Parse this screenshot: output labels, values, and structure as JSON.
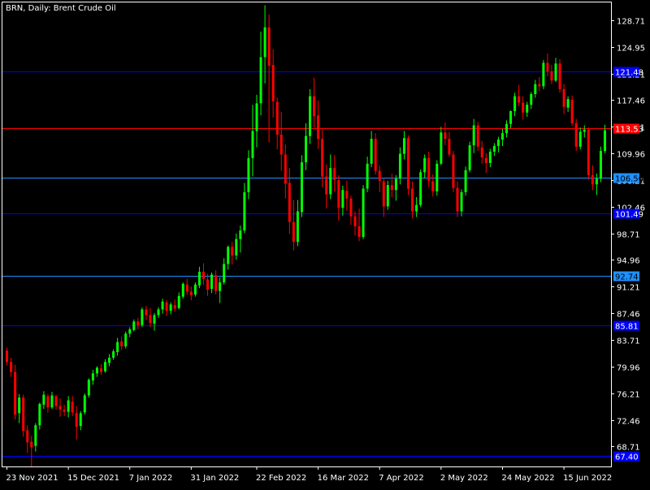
{
  "header": {
    "symbol_label": "BRN, Daily:  Brent Crude Oil"
  },
  "colors": {
    "background": "#000000",
    "axis": "#ffffff",
    "bull_candle": "#00ff00",
    "bear_candle": "#ff0000",
    "red_level": "#ff0000",
    "deep_blue_level": "#0000ff",
    "light_blue_level": "#1e90ff"
  },
  "chart_data": {
    "type": "candlestick",
    "title": "BRN, Daily:  Brent Crude Oil",
    "timeframe": "Daily",
    "y_ticks": [
      "128.71",
      "124.95",
      "121.21",
      "117.46",
      "113.71",
      "109.96",
      "106.21",
      "102.46",
      "98.71",
      "94.96",
      "91.21",
      "87.46",
      "83.71",
      "79.96",
      "76.21",
      "72.46",
      "68.71"
    ],
    "ylim": [
      65.9,
      131.2
    ],
    "x_ticks": [
      "23 Nov 2021",
      "15 Dec 2021",
      "7 Jan 2022",
      "31 Jan 2022",
      "22 Feb 2022",
      "16 Mar 2022",
      "7 Apr 2022",
      "2 May 2022",
      "24 May 2022",
      "15 Jun 2022"
    ],
    "levels": [
      {
        "value": 121.48,
        "label": "121.48",
        "color": "deep-blue"
      },
      {
        "value": 113.53,
        "label": "113.53",
        "color": "red"
      },
      {
        "value": 106.56,
        "label": "106.56",
        "color": "light-blue"
      },
      {
        "value": 101.49,
        "label": "101.49",
        "color": "deep-blue"
      },
      {
        "value": 92.74,
        "label": "92.74",
        "color": "light-blue"
      },
      {
        "value": 85.81,
        "label": "85.81",
        "color": "deep-blue"
      },
      {
        "value": 67.4,
        "label": "67.40",
        "color": "deep-blue"
      }
    ],
    "candles_ohlc": [
      [
        82.2,
        82.6,
        80.1,
        80.6
      ],
      [
        80.6,
        81.2,
        78.5,
        79.2
      ],
      [
        79.2,
        80.2,
        72.5,
        73.2
      ],
      [
        73.4,
        76.1,
        72.0,
        75.6
      ],
      [
        75.6,
        76.0,
        70.1,
        70.9
      ],
      [
        71.0,
        71.7,
        67.8,
        69.3
      ],
      [
        69.4,
        70.2,
        65.9,
        68.6
      ],
      [
        68.8,
        72.0,
        68.0,
        71.7
      ],
      [
        71.7,
        74.9,
        71.1,
        74.7
      ],
      [
        74.6,
        76.5,
        74.0,
        76.0
      ],
      [
        75.8,
        76.1,
        73.5,
        74.2
      ],
      [
        74.2,
        76.4,
        74.0,
        75.9
      ],
      [
        75.8,
        76.0,
        73.9,
        74.4
      ],
      [
        74.4,
        75.5,
        72.9,
        73.9
      ],
      [
        73.9,
        74.6,
        73.0,
        73.6
      ],
      [
        73.6,
        75.8,
        72.8,
        75.2
      ],
      [
        75.0,
        75.8,
        73.0,
        73.5
      ],
      [
        73.4,
        74.4,
        69.7,
        71.5
      ],
      [
        71.6,
        73.7,
        71.0,
        73.4
      ],
      [
        73.5,
        76.2,
        73.2,
        75.9
      ],
      [
        75.9,
        78.3,
        75.6,
        78.1
      ],
      [
        78.0,
        79.5,
        77.4,
        79.0
      ],
      [
        79.0,
        80.0,
        78.5,
        79.8
      ],
      [
        79.7,
        80.3,
        78.8,
        79.2
      ],
      [
        79.3,
        81.0,
        79.1,
        80.6
      ],
      [
        80.5,
        81.7,
        80.0,
        81.2
      ],
      [
        81.2,
        82.4,
        80.9,
        82.1
      ],
      [
        82.0,
        84.0,
        81.5,
        83.4
      ],
      [
        83.5,
        84.2,
        82.3,
        82.8
      ],
      [
        82.8,
        84.9,
        82.5,
        84.6
      ],
      [
        84.6,
        85.5,
        84.1,
        85.2
      ],
      [
        85.1,
        86.6,
        84.9,
        86.3
      ],
      [
        86.3,
        86.8,
        85.2,
        85.8
      ],
      [
        85.8,
        88.3,
        85.5,
        88.0
      ],
      [
        88.0,
        88.5,
        86.5,
        87.2
      ],
      [
        87.2,
        88.2,
        85.5,
        86.1
      ],
      [
        86.0,
        87.5,
        85.0,
        87.2
      ],
      [
        87.2,
        88.3,
        86.8,
        88.0
      ],
      [
        88.0,
        89.5,
        87.4,
        89.1
      ],
      [
        89.0,
        89.3,
        87.1,
        87.8
      ],
      [
        87.8,
        89.0,
        87.3,
        88.7
      ],
      [
        88.6,
        89.4,
        87.7,
        88.1
      ],
      [
        88.2,
        90.4,
        88.0,
        89.9
      ],
      [
        89.8,
        91.8,
        89.5,
        91.6
      ],
      [
        91.5,
        92.3,
        90.0,
        90.5
      ],
      [
        90.5,
        91.2,
        89.3,
        90.0
      ],
      [
        90.1,
        91.8,
        89.8,
        91.5
      ],
      [
        91.4,
        94.0,
        91.0,
        93.3
      ],
      [
        93.3,
        94.5,
        91.5,
        92.3
      ],
      [
        92.2,
        93.0,
        89.9,
        90.8
      ],
      [
        90.9,
        93.2,
        90.3,
        92.9
      ],
      [
        92.8,
        93.5,
        90.1,
        90.6
      ],
      [
        90.6,
        92.5,
        88.9,
        91.8
      ],
      [
        91.8,
        95.2,
        91.5,
        94.4
      ],
      [
        94.4,
        97.0,
        93.6,
        96.8
      ],
      [
        96.8,
        97.5,
        94.3,
        95.6
      ],
      [
        95.6,
        98.7,
        95.0,
        97.9
      ],
      [
        97.9,
        99.8,
        96.0,
        99.1
      ],
      [
        99.1,
        105.8,
        98.7,
        104.5
      ],
      [
        104.5,
        110.4,
        103.5,
        109.3
      ],
      [
        109.3,
        116.8,
        106.7,
        113.1
      ],
      [
        113.1,
        118.2,
        110.8,
        117.0
      ],
      [
        117.0,
        127.1,
        115.3,
        123.5
      ],
      [
        123.5,
        130.8,
        119.8,
        127.7
      ],
      [
        127.7,
        129.5,
        111.5,
        122.3
      ],
      [
        122.4,
        124.6,
        115.0,
        117.3
      ],
      [
        117.2,
        117.8,
        110.5,
        112.6
      ],
      [
        112.6,
        115.8,
        107.5,
        109.8
      ],
      [
        109.8,
        111.2,
        103.6,
        105.7
      ],
      [
        105.8,
        107.9,
        98.6,
        100.3
      ],
      [
        100.3,
        103.4,
        96.3,
        97.5
      ],
      [
        97.5,
        103.4,
        96.9,
        101.8
      ],
      [
        101.7,
        109.7,
        101.0,
        108.7
      ],
      [
        108.7,
        114.2,
        107.6,
        112.4
      ],
      [
        112.4,
        119.0,
        111.3,
        118.0
      ],
      [
        118.0,
        120.6,
        113.6,
        115.2
      ],
      [
        115.3,
        117.4,
        110.6,
        112.0
      ],
      [
        112.0,
        113.3,
        105.2,
        106.7
      ],
      [
        106.7,
        108.4,
        102.2,
        104.2
      ],
      [
        104.2,
        109.8,
        103.5,
        107.9
      ],
      [
        107.9,
        109.7,
        104.6,
        106.2
      ],
      [
        106.2,
        106.9,
        100.5,
        102.3
      ],
      [
        102.3,
        105.4,
        101.2,
        104.8
      ],
      [
        104.7,
        106.1,
        101.9,
        103.6
      ],
      [
        103.6,
        104.0,
        99.9,
        101.1
      ],
      [
        101.1,
        101.8,
        98.4,
        99.7
      ],
      [
        99.7,
        102.2,
        97.6,
        98.2
      ],
      [
        98.2,
        105.5,
        97.9,
        105.0
      ],
      [
        105.0,
        109.5,
        104.5,
        108.5
      ],
      [
        108.5,
        113.1,
        108.0,
        112.0
      ],
      [
        112.0,
        112.8,
        107.0,
        107.5
      ],
      [
        107.5,
        108.2,
        104.5,
        106.1
      ],
      [
        106.0,
        106.5,
        101.0,
        102.5
      ],
      [
        102.5,
        106.1,
        102.0,
        105.5
      ],
      [
        105.5,
        107.1,
        103.8,
        104.8
      ],
      [
        104.8,
        106.9,
        103.3,
        106.4
      ],
      [
        106.4,
        110.8,
        105.6,
        109.9
      ],
      [
        109.9,
        113.1,
        109.1,
        112.1
      ],
      [
        112.1,
        112.5,
        104.1,
        105.0
      ],
      [
        105.0,
        106.0,
        100.8,
        101.8
      ],
      [
        101.8,
        103.8,
        101.0,
        102.7
      ],
      [
        102.7,
        107.7,
        102.4,
        107.3
      ],
      [
        107.3,
        109.8,
        106.5,
        109.3
      ],
      [
        109.3,
        110.2,
        105.2,
        106.1
      ],
      [
        106.0,
        107.0,
        103.9,
        104.6
      ],
      [
        104.6,
        109.0,
        104.0,
        108.5
      ],
      [
        108.5,
        113.7,
        108.3,
        112.9
      ],
      [
        112.9,
        114.3,
        111.1,
        112.0
      ],
      [
        112.0,
        113.0,
        109.5,
        109.8
      ],
      [
        109.8,
        110.3,
        104.5,
        105.1
      ],
      [
        105.1,
        106.0,
        101.0,
        101.8
      ],
      [
        101.8,
        104.9,
        101.1,
        104.5
      ],
      [
        104.5,
        108.1,
        104.0,
        107.6
      ],
      [
        107.6,
        111.6,
        107.3,
        111.1
      ],
      [
        111.1,
        114.8,
        110.0,
        113.9
      ],
      [
        113.9,
        114.4,
        110.3,
        110.9
      ],
      [
        110.8,
        111.7,
        108.5,
        109.4
      ],
      [
        109.3,
        110.0,
        107.2,
        108.6
      ],
      [
        108.6,
        110.6,
        108.0,
        110.2
      ],
      [
        110.2,
        111.4,
        109.6,
        111.0
      ],
      [
        111.0,
        112.3,
        110.1,
        111.9
      ],
      [
        111.9,
        113.4,
        111.0,
        112.8
      ],
      [
        112.8,
        114.6,
        112.2,
        114.1
      ],
      [
        114.1,
        116.0,
        113.5,
        115.9
      ],
      [
        115.9,
        118.5,
        115.2,
        118.0
      ],
      [
        118.0,
        119.6,
        116.6,
        117.1
      ],
      [
        117.1,
        118.0,
        114.7,
        115.7
      ],
      [
        115.7,
        117.2,
        115.1,
        116.8
      ],
      [
        116.8,
        118.6,
        116.2,
        118.3
      ],
      [
        118.3,
        120.3,
        117.8,
        119.7
      ],
      [
        119.7,
        120.7,
        118.7,
        119.4
      ],
      [
        119.4,
        123.1,
        119.0,
        122.7
      ],
      [
        122.7,
        124.0,
        120.8,
        121.5
      ],
      [
        121.5,
        122.4,
        119.7,
        120.2
      ],
      [
        120.2,
        123.4,
        120.0,
        122.6
      ],
      [
        122.6,
        123.2,
        118.5,
        119.0
      ],
      [
        119.0,
        119.7,
        115.5,
        116.5
      ],
      [
        116.4,
        118.0,
        115.8,
        117.6
      ],
      [
        117.5,
        118.1,
        113.8,
        114.2
      ],
      [
        114.2,
        114.8,
        110.3,
        110.9
      ],
      [
        110.9,
        113.6,
        110.5,
        113.0
      ],
      [
        113.0,
        113.9,
        112.2,
        113.3
      ],
      [
        113.3,
        113.6,
        106.2,
        106.9
      ],
      [
        106.9,
        108.3,
        104.8,
        105.6
      ],
      [
        105.6,
        107.1,
        104.1,
        106.4
      ],
      [
        106.4,
        110.9,
        105.9,
        110.3
      ],
      [
        110.3,
        114.0,
        110.0,
        113.2
      ]
    ]
  }
}
